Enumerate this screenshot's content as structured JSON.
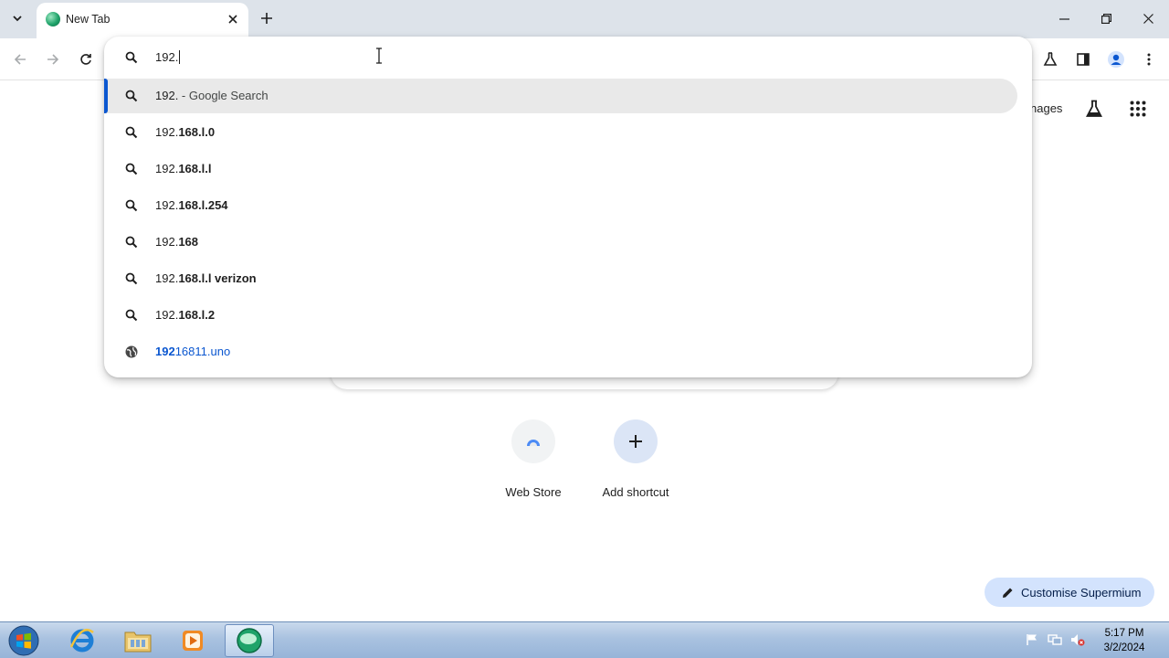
{
  "browser": {
    "tab": {
      "title": "New Tab"
    },
    "window_controls": {
      "minimize": "–",
      "maximize": "❐",
      "close": "✕"
    }
  },
  "omnibox": {
    "value": "192.",
    "suggestions": [
      {
        "icon": "search-icon",
        "plain": "192.",
        "bold": "",
        "suffix": " - Google Search",
        "selected": true
      },
      {
        "icon": "search-icon",
        "plain": "192.",
        "bold": "168.l.0",
        "suffix": ""
      },
      {
        "icon": "search-icon",
        "plain": "192.",
        "bold": "168.l.l",
        "suffix": ""
      },
      {
        "icon": "search-icon",
        "plain": "192.",
        "bold": "168.l.254",
        "suffix": ""
      },
      {
        "icon": "search-icon",
        "plain": "192.",
        "bold": "168",
        "suffix": ""
      },
      {
        "icon": "search-icon",
        "plain": "192.",
        "bold": "168.l.l verizon",
        "suffix": ""
      },
      {
        "icon": "search-icon",
        "plain": "192.",
        "bold": "168.l.2",
        "suffix": ""
      },
      {
        "icon": "globe-icon",
        "bold_first": "192",
        "rest": "16811.uno"
      }
    ]
  },
  "page": {
    "images_link": "nages",
    "shortcuts": [
      {
        "label": "Web Store"
      },
      {
        "label": "Add shortcut"
      }
    ],
    "customise_label": "Customise Supermium"
  },
  "taskbar": {
    "time": "5:17 PM",
    "date": "3/2/2024"
  },
  "colors": {
    "accent": "#0b57d0",
    "tabstrip": "#dde3ea",
    "customise_bg": "#d3e3fd",
    "taskbar": "#a9c2e0"
  }
}
